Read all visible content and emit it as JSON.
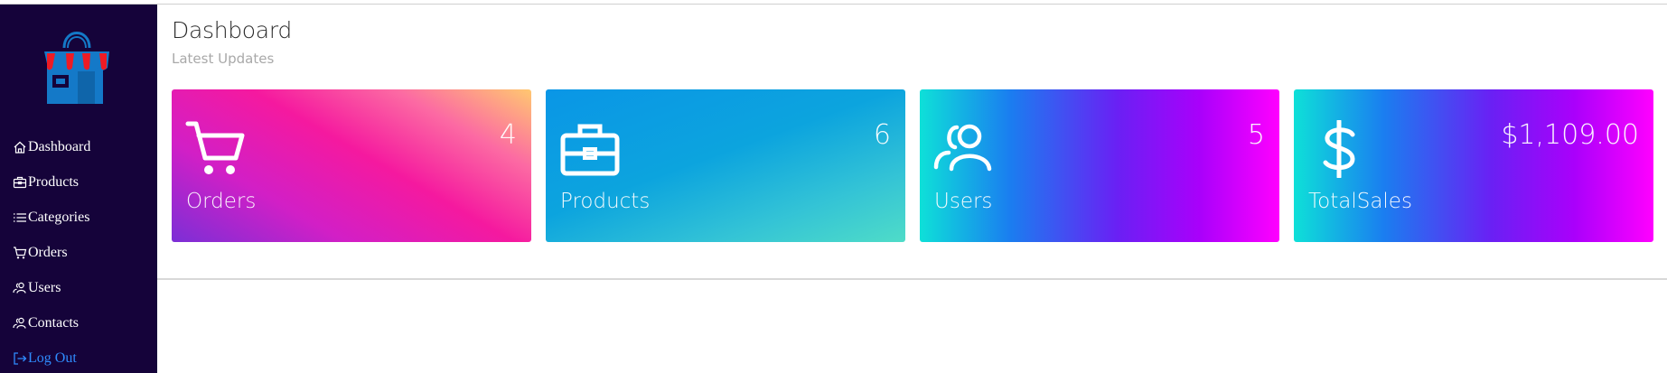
{
  "sidebar": {
    "items": [
      {
        "label": "Dashboard",
        "icon": "house-icon"
      },
      {
        "label": "Products",
        "icon": "briefcase-icon"
      },
      {
        "label": "Categories",
        "icon": "list-icon"
      },
      {
        "label": "Orders",
        "icon": "cart-icon"
      },
      {
        "label": "Users",
        "icon": "users-icon"
      },
      {
        "label": "Contacts",
        "icon": "users-icon"
      },
      {
        "label": "Log Out",
        "icon": "logout-icon"
      }
    ]
  },
  "header": {
    "title": "Dashboard",
    "subtitle": "Latest Updates"
  },
  "cards": [
    {
      "label": "Orders",
      "value": "4",
      "icon": "cart-icon"
    },
    {
      "label": "Products",
      "value": "6",
      "icon": "briefcase-icon"
    },
    {
      "label": "Users",
      "value": "5",
      "icon": "users-icon"
    },
    {
      "label": "TotalSales",
      "value": "$1,109.00",
      "icon": "dollar-icon"
    }
  ],
  "colors": {
    "sidebar_bg": "#15033a",
    "logout_link": "#2f8cff",
    "logo_blue": "#1479c8",
    "logo_red": "#ee1b24"
  }
}
